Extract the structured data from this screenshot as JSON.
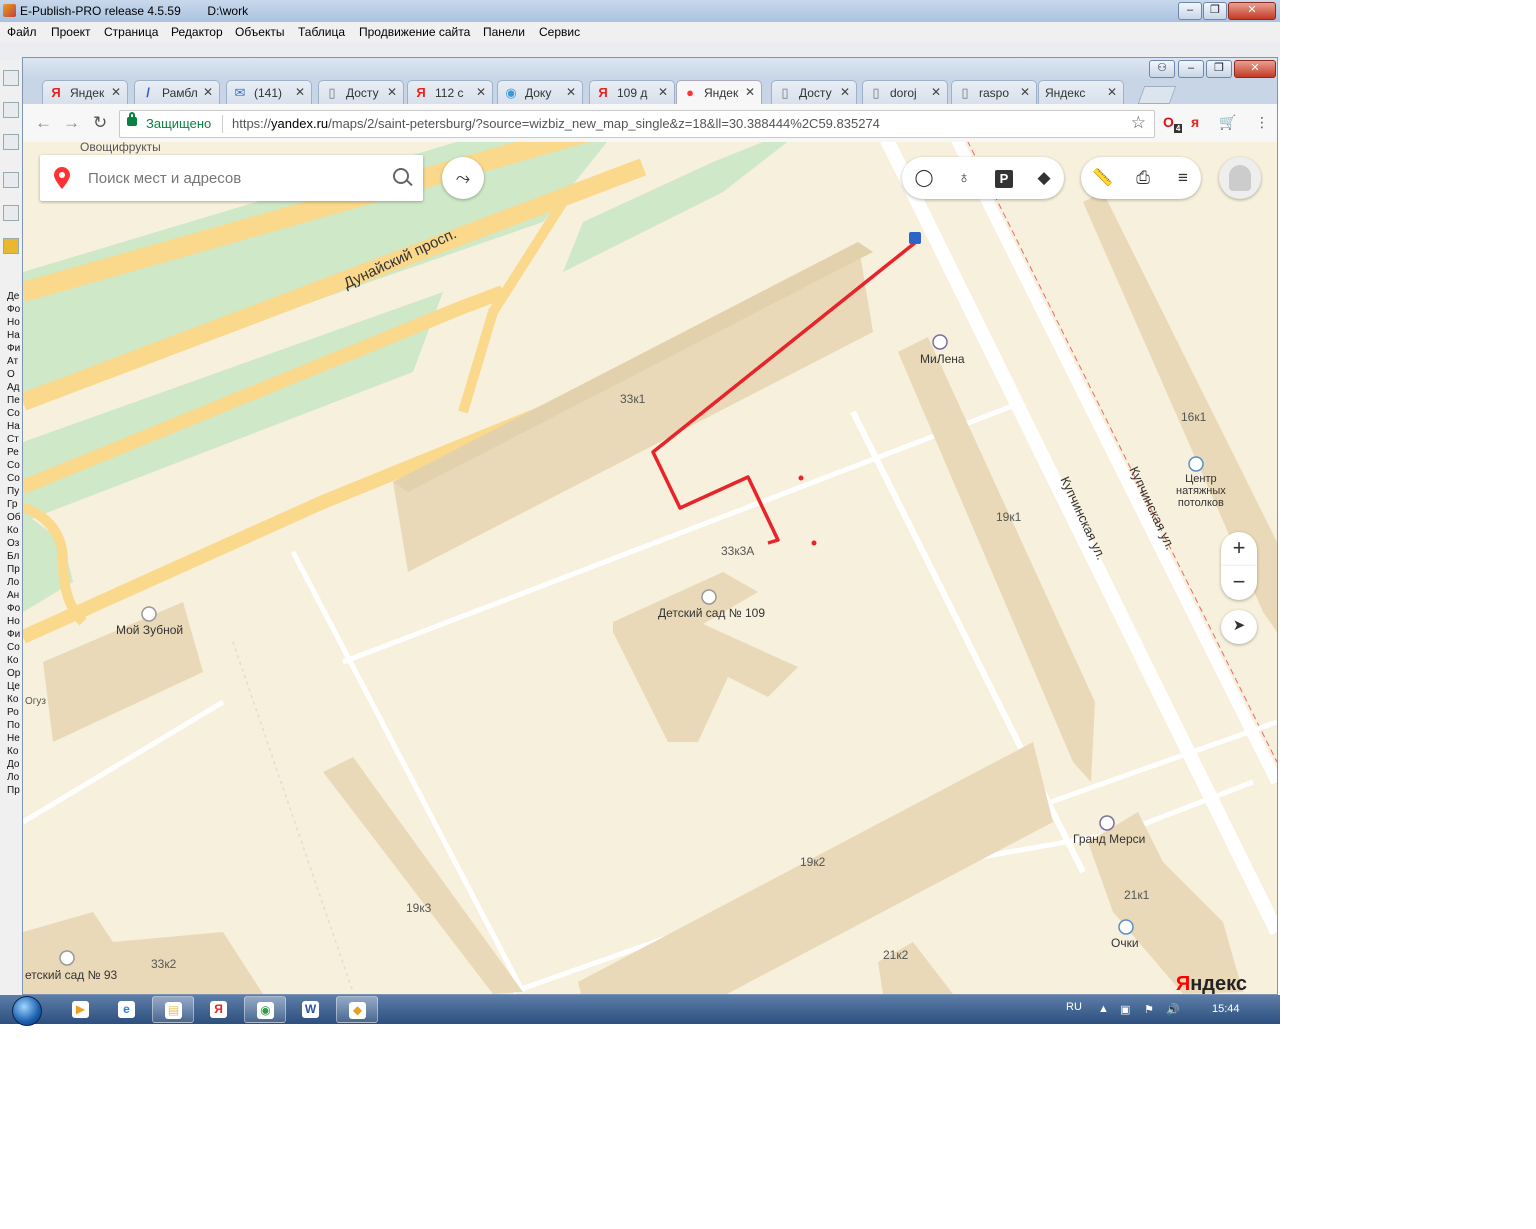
{
  "outer_window": {
    "title": "E-Publish-PRO release 4.5.59        D:\\work",
    "menu": [
      "Файл",
      "Проект",
      "Страница",
      "Редактор",
      "Объекты",
      "Таблица",
      "Продвижение сайта",
      "Панели",
      "Сервис"
    ],
    "left_letters": [
      "Де",
      "Фо",
      "Но",
      "На",
      "Фи",
      "Ат",
      "О",
      "Ад",
      "Пе",
      "Со",
      "На",
      "Ст",
      "Ре",
      "Со",
      "Со",
      "Пу",
      "Гр",
      "Об",
      "Ко",
      "Оз",
      "Бл",
      "Пр",
      "Ло",
      "Ан",
      "Фо",
      "Но",
      "Фи",
      "Со",
      "Ко",
      "Ор",
      "Це",
      "Ко",
      "Ро",
      "По",
      "Не",
      "Ко",
      "До",
      "Ло",
      "Пр"
    ]
  },
  "browser": {
    "tabs": [
      {
        "icon": "Я",
        "icon_color": "#e52620",
        "label": "Яндек"
      },
      {
        "icon": "/",
        "icon_color": "#3355cc",
        "label": "Рамбл"
      },
      {
        "icon": "✉",
        "icon_color": "#3b6fd4",
        "label": "(141)"
      },
      {
        "icon": "▯",
        "icon_color": "#777777",
        "label": "Досту"
      },
      {
        "icon": "Я",
        "icon_color": "#e52620",
        "label": "112 с"
      },
      {
        "icon": "◉",
        "icon_color": "#3a9ad9",
        "label": "Доку"
      },
      {
        "icon": "Я",
        "icon_color": "#e52620",
        "label": "109 д"
      },
      {
        "icon": "●",
        "icon_color": "#f33",
        "label": "Яндек"
      },
      {
        "icon": "▯",
        "icon_color": "#777777",
        "label": "Досту"
      },
      {
        "icon": "▯",
        "icon_color": "#777777",
        "label": "doroj"
      },
      {
        "icon": "▯",
        "icon_color": "#777777",
        "label": "raspo"
      },
      {
        "icon": "",
        "icon_color": "#777777",
        "label": "Яндекс"
      }
    ],
    "active_tab_index": 7,
    "secure_label": "Защищено",
    "url_scheme": "https://",
    "url_host": "yandex.ru",
    "url_path": "/maps/2/saint-petersburg/?source=wizbiz_new_map_single&z=18&ll=30.388444%2C59.835274",
    "ext_badge": "4"
  },
  "map": {
    "search_placeholder": "Поиск мест и адресов",
    "labels": {
      "ovoshchi": "Овощифрукты",
      "dunaisky": "Дунайский просп.",
      "b33k1": "33к1",
      "milena": "МиЛена",
      "b16k1": "16к1",
      "ceiling": "Центр\nнатяжных\nпотолков",
      "kupch1": "Купчинская ул.",
      "kupch2": "Купчинская ул.",
      "b19k1": "19к1",
      "b33k3a": "33к3А",
      "kindergarten109": "Детский сад № 109",
      "zubnoy": "Мой Зубной",
      "b19k2": "19к2",
      "b19k3": "19к3",
      "grand": "Гранд Мерси",
      "b21k1": "21к1",
      "ochki": "Очки",
      "b21k2": "21к2",
      "kindergarten93": "етский сад № 93",
      "b33k2": "33к2",
      "oguz": "Огуз"
    },
    "logo_first": "Я",
    "logo_rest": "ндекс",
    "route_color": "#e8232a"
  },
  "taskbar": {
    "lang": "RU",
    "time": "15:44",
    "apps": [
      {
        "name": "media",
        "glyph": "▶",
        "color": "#f0a020",
        "open": false
      },
      {
        "name": "ie",
        "glyph": "e",
        "color": "#2a7fd4",
        "open": false
      },
      {
        "name": "explorer",
        "glyph": "▤",
        "color": "#e6c35a",
        "open": true
      },
      {
        "name": "yandex",
        "glyph": "Я",
        "color": "#e52620",
        "open": false
      },
      {
        "name": "chrome",
        "glyph": "◉",
        "color": "#2f9e44",
        "open": true
      },
      {
        "name": "word",
        "glyph": "W",
        "color": "#2b579a",
        "open": false
      },
      {
        "name": "epublish",
        "glyph": "◆",
        "color": "#e8a020",
        "open": true
      }
    ]
  }
}
